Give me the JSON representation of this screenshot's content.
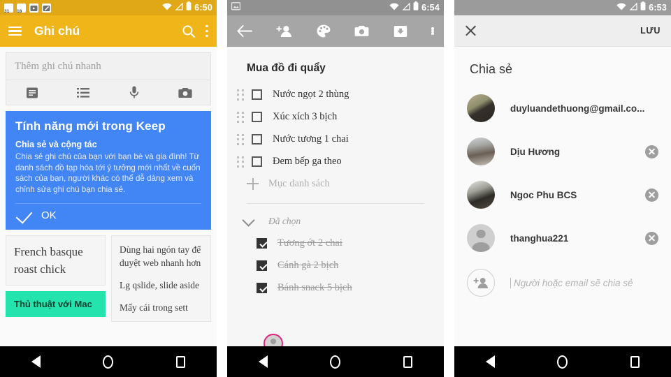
{
  "panel1": {
    "status": {
      "time": "6:50",
      "icons": [
        "calendar-31-icon",
        "calendar-18-icon",
        "app-icon-1",
        "app-icon-2",
        "wifi-icon",
        "signal-icon",
        "battery-icon"
      ],
      "cal1": "31",
      "cal2": "18"
    },
    "appbar": {
      "title": "Ghi chú",
      "menu_icon": "hamburger-icon",
      "search_icon": "search-icon",
      "overflow_icon": "kebab-icon"
    },
    "quick_note": {
      "placeholder": "Thêm ghi chú nhanh",
      "tools": [
        "note-icon",
        "list-icon",
        "microphone-icon",
        "camera-icon"
      ]
    },
    "promo_card": {
      "title": "Tính năng mới trong Keep",
      "subtitle": "Chia sẻ và cộng tác",
      "body": "Chia sẻ ghi chú của bạn với bạn bè và gia đình! Từ danh sách đồ tạp hóa tới ý tưởng mới nhất về cuốn sách của bạn, người khác có thể dễ dàng xem và chỉnh sửa ghi chú bạn chia sẻ.",
      "action": "OK",
      "color": "#4285F4"
    },
    "notes": {
      "left": [
        {
          "text": "French basque roast chick",
          "style": "plain",
          "color": "#F5F5F5"
        },
        {
          "text": "Thủ thuật với Mac",
          "style": "green",
          "color": "#25E3AC"
        }
      ],
      "right": [
        {
          "lines": [
            "Dùng hai ngón tay để duyệt web nhanh hơn",
            "Lg qslide, slide aside",
            "Mấy cái trong sett"
          ],
          "style": "small",
          "color": "#F5F5F5"
        }
      ]
    }
  },
  "panel2": {
    "status": {
      "time": "6:54",
      "icons": [
        "image-icon",
        "wifi-icon",
        "signal-icon",
        "battery-icon"
      ]
    },
    "appbar": {
      "icons": [
        "back-arrow-icon",
        "add-person-icon",
        "palette-icon",
        "camera-icon",
        "archive-icon",
        "kebab-icon"
      ],
      "color": "#A6A6A6"
    },
    "note_title": "Mua đồ đi quẩy",
    "items": [
      {
        "label": "Nước ngọt 2 thùng",
        "checked": false
      },
      {
        "label": "Xúc xích 3 bịch",
        "checked": false
      },
      {
        "label": "Nước tương 1 chai",
        "checked": false
      },
      {
        "label": "Đem bếp ga theo",
        "checked": false
      }
    ],
    "add_item": "Mục danh sách",
    "checked_header": "Đã chọn",
    "checked_items": [
      {
        "label": "Tương ớt 2 chai",
        "checked": true
      },
      {
        "label": "Cánh gà 2 bịch",
        "checked": true
      },
      {
        "label": "Bánh snack 5 bịch",
        "checked": true
      }
    ],
    "collaborator_avatar": {
      "highlight_color": "#E0267C"
    }
  },
  "panel3": {
    "status": {
      "time": "6:53",
      "icons": [
        "wifi-icon",
        "signal-icon",
        "battery-icon"
      ]
    },
    "appbar": {
      "close_icon": "close-icon",
      "save_label": "LƯU"
    },
    "heading": "Chia sẻ",
    "people": [
      {
        "name": "duyluandethuong@gmail.co...",
        "avatar": "photo",
        "removable": false
      },
      {
        "name": "Dịu Hương",
        "avatar": "photo",
        "removable": true
      },
      {
        "name": "Ngoc Phu BCS",
        "avatar": "photo",
        "removable": true
      },
      {
        "name": "thanghua221",
        "avatar": "placeholder",
        "removable": true
      }
    ],
    "add_placeholder": "Người hoặc email sẽ chia sẻ",
    "add_icon": "add-person-icon"
  },
  "navbar": {
    "back": "back-triangle-icon",
    "home": "home-circle-icon",
    "recents": "recents-square-icon"
  }
}
